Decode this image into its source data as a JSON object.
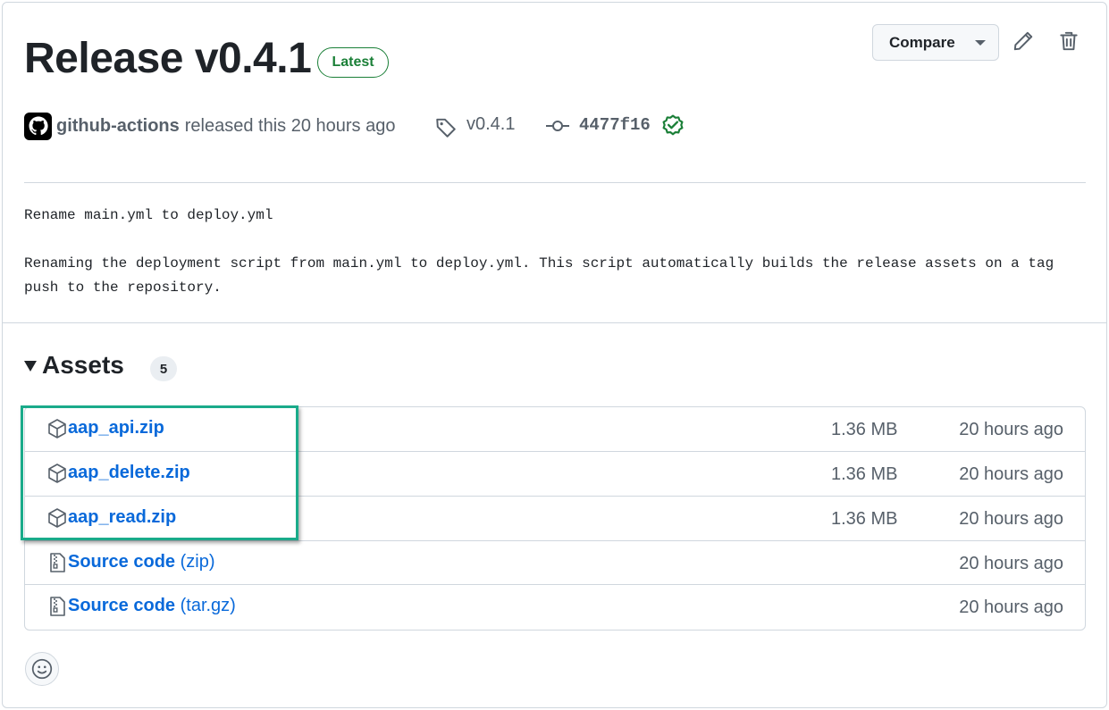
{
  "release": {
    "title": "Release v0.4.1",
    "badge": "Latest",
    "compare_label": "Compare",
    "author": "github-actions",
    "released_text": "released this 20 hours ago",
    "tag": "v0.4.1",
    "commit": "4477f16"
  },
  "body": {
    "line1": "Rename main.yml to deploy.yml",
    "line2": "Renaming the deployment script from main.yml to deploy.yml. This script automatically builds the release assets on a tag",
    "line3": "push to the repository."
  },
  "assets": {
    "title": "Assets",
    "count": "5",
    "items": [
      {
        "name": "aap_api.zip",
        "suffix": "",
        "size": "1.36 MB",
        "time": "20 hours ago",
        "icon": "package-icon"
      },
      {
        "name": "aap_delete.zip",
        "suffix": "",
        "size": "1.36 MB",
        "time": "20 hours ago",
        "icon": "package-icon"
      },
      {
        "name": "aap_read.zip",
        "suffix": "",
        "size": "1.36 MB",
        "time": "20 hours ago",
        "icon": "package-icon"
      },
      {
        "name": "Source code",
        "suffix": " (zip)",
        "size": "",
        "time": "20 hours ago",
        "icon": "file-zip-icon"
      },
      {
        "name": "Source code",
        "suffix": " (tar.gz)",
        "size": "",
        "time": "20 hours ago",
        "icon": "file-zip-icon"
      }
    ]
  },
  "colors": {
    "link": "#0969da",
    "latest_green": "#1a7f37",
    "highlight": "#1aab8a"
  }
}
